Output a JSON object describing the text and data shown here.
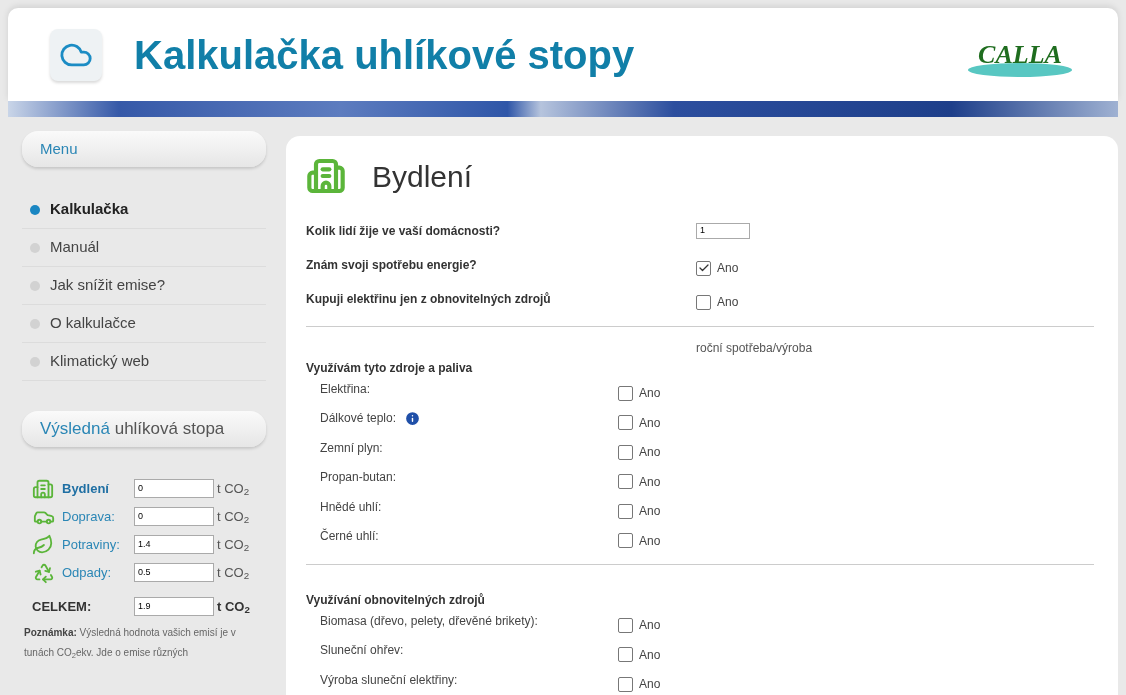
{
  "header": {
    "title": "Kalkulačka uhlíkové stopy",
    "logo": "CALLA"
  },
  "menu": {
    "title": "Menu",
    "items": [
      {
        "label": "Kalkulačka",
        "selected": true
      },
      {
        "label": "Manuál",
        "selected": false
      },
      {
        "label": "Jak snížit emise?",
        "selected": false
      },
      {
        "label": "O kalkulačce",
        "selected": false
      },
      {
        "label": "Klimatický web",
        "selected": false
      }
    ]
  },
  "results": {
    "title_highlight": "Výsledná",
    "title_rest": "uhlíková stopa",
    "rows": [
      {
        "kind": "housing",
        "label": "Bydlení",
        "value": "0",
        "unit": "t CO$_{2}$",
        "selected": true
      },
      {
        "kind": "transport",
        "label": "Doprava:",
        "value": "0",
        "unit": "t CO$_{2}$",
        "selected": false
      },
      {
        "kind": "food",
        "label": "Potraviny:",
        "value": "1.4",
        "unit": "t CO$_{2}$",
        "selected": false
      },
      {
        "kind": "waste",
        "label": "Odpady:",
        "value": "0.5",
        "unit": "t CO$_{2}$",
        "selected": false
      }
    ],
    "total": {
      "label": "CELKEM:",
      "value": "1.9",
      "unit": "t CO$_{2}$"
    },
    "note": "**Poznámka:** Výsledná hodnota vašich emisí je v tunách CO$_{2}$ekv. Jde o emise různých"
  },
  "content": {
    "title": "Bydlení",
    "questions": [
      {
        "kind": "number",
        "label": "Kolik lidí žije ve vaší domácnosti?",
        "value": "1"
      },
      {
        "kind": "checkbox",
        "label": "Znám svoji spotřebu energie?",
        "option": "Ano",
        "checked": true
      },
      {
        "kind": "checkbox",
        "label": "Kupuji elektřinu jen z obnovitelných zdrojů",
        "option": "Ano",
        "checked": false
      }
    ],
    "column_header": "roční spotřeba/výroba",
    "sections": [
      {
        "title": "Využívám tyto zdroje a paliva",
        "items": [
          {
            "label": "Elektřina:",
            "info": false,
            "option": "Ano",
            "checked": false
          },
          {
            "label": "Dálkové teplo:",
            "info": true,
            "option": "Ano",
            "checked": false
          },
          {
            "label": "Zemní plyn:",
            "info": false,
            "option": "Ano",
            "checked": false
          },
          {
            "label": "Propan-butan:",
            "info": false,
            "option": "Ano",
            "checked": false
          },
          {
            "label": "Hnědé uhlí:",
            "info": false,
            "option": "Ano",
            "checked": false
          },
          {
            "label": "Černé uhlí:",
            "info": false,
            "option": "Ano",
            "checked": false
          }
        ]
      },
      {
        "title": "Využívání obnovitelných zdrojů",
        "items": [
          {
            "label": "Biomasa (dřevo, pelety, dřevěné brikety):",
            "info": false,
            "option": "Ano",
            "checked": false
          },
          {
            "label": "Sluneční ohřev:",
            "info": false,
            "option": "Ano",
            "checked": false
          },
          {
            "label": "Výroba sluneční elektřiny:",
            "info": false,
            "option": "Ano",
            "checked": false
          }
        ]
      }
    ]
  }
}
